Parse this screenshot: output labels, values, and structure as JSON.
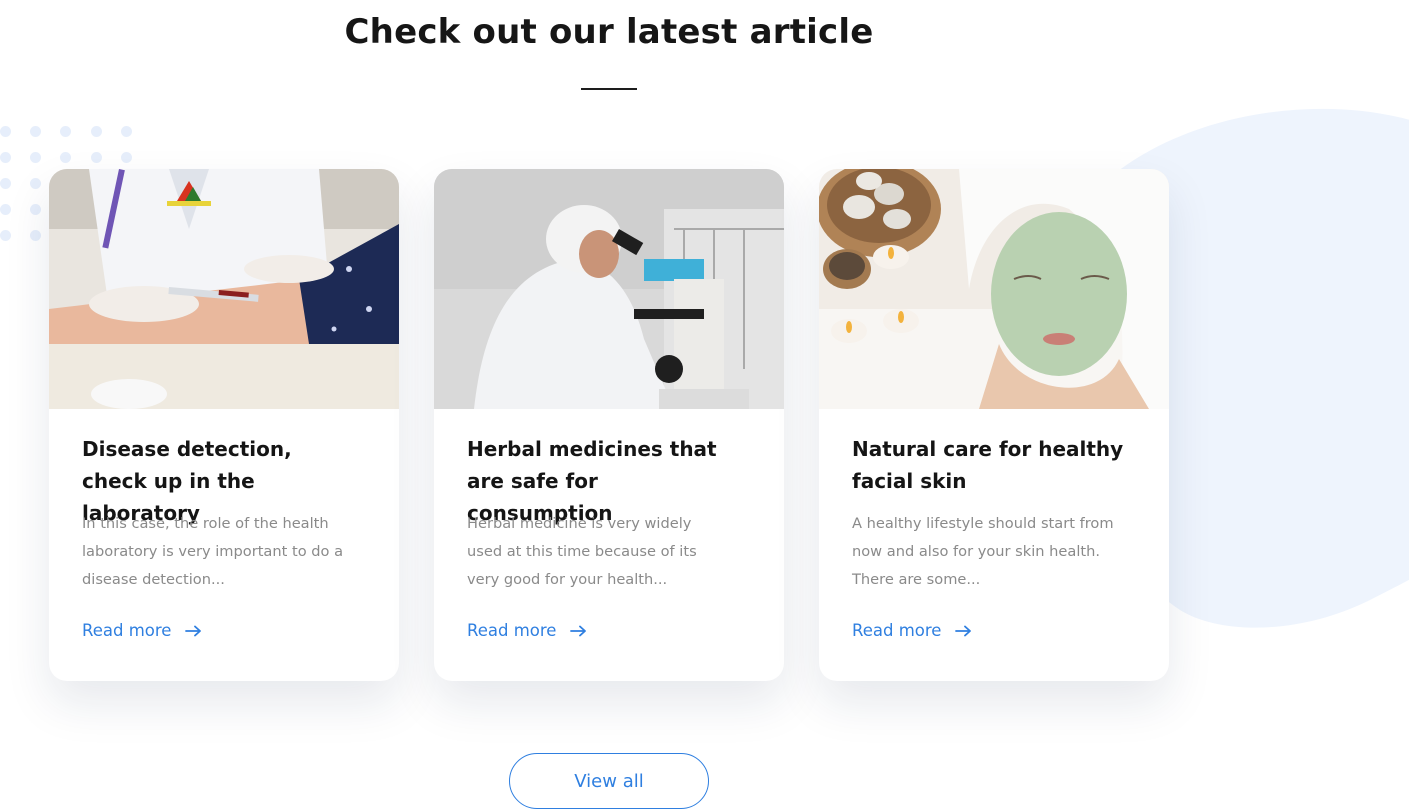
{
  "section": {
    "title": "Check out our latest article"
  },
  "articles": [
    {
      "title": "Disease detection, check up in the laboratory",
      "description": "In this case, the role of the health laboratory is very important to do a disease detection...",
      "link_label": "Read more",
      "image": "blood-test-photo"
    },
    {
      "title": "Herbal medicines that are safe for consumption",
      "description": "Herbal medicine is very widely used at this time because of its very good for your health...",
      "link_label": "Read more",
      "image": "microscope-lab-photo"
    },
    {
      "title": "Natural care for healthy facial skin",
      "description": "A healthy lifestyle should start from now and also for your skin health. There are some...",
      "link_label": "Read more",
      "image": "facial-mask-spa-photo"
    }
  ],
  "view_all_label": "View all",
  "colors": {
    "accent": "#2f7fe0",
    "title": "#151515",
    "body_text": "#8a8a8a",
    "blob": "#eef4fd"
  }
}
